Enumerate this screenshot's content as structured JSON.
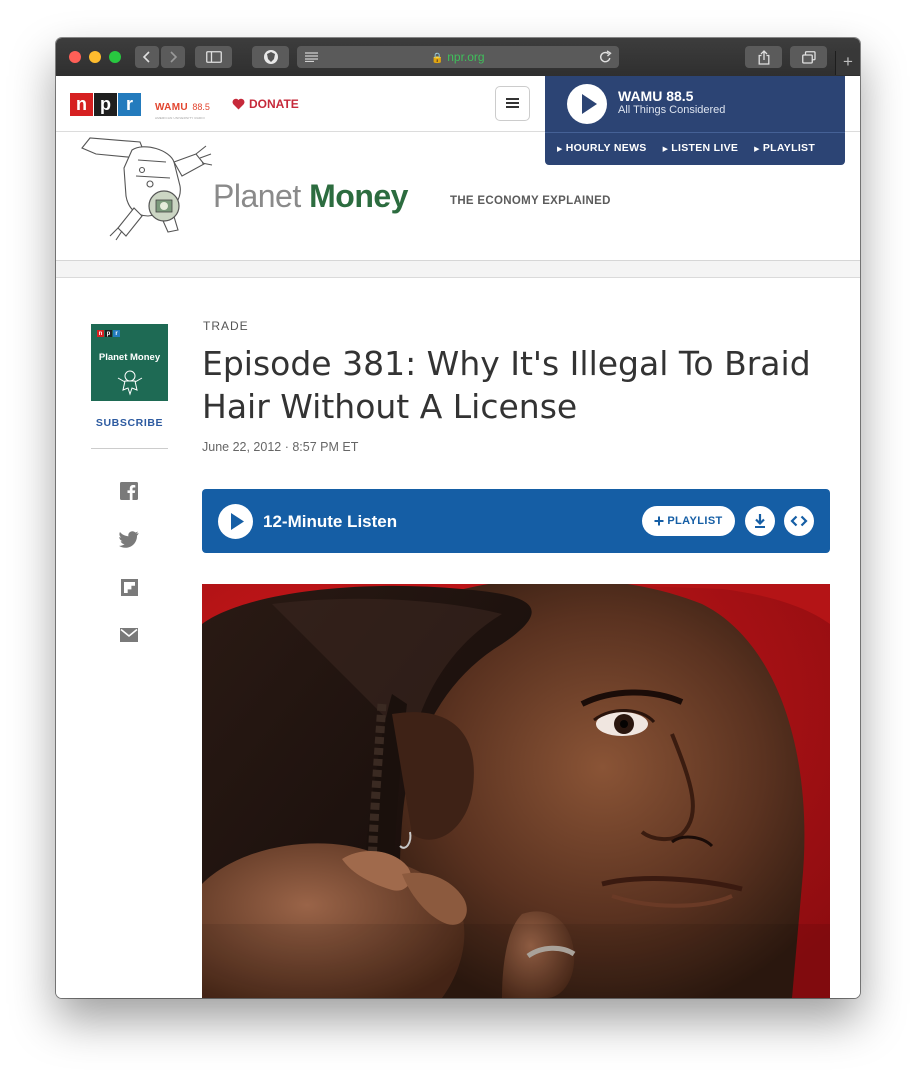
{
  "browser": {
    "url": "npr.org"
  },
  "header": {
    "npr_letters": [
      "n",
      "p",
      "r"
    ],
    "npr_colors": [
      "#d62021",
      "#1f1f1f",
      "#237bbd"
    ],
    "station_logo": "WAMU",
    "station_freq": "88.5",
    "station_tagline": "AMERICAN UNIVERSITY RADIO",
    "donate_label": "DONATE"
  },
  "radio": {
    "station": "WAMU 88.5",
    "program": "All Things Considered",
    "links": [
      "HOURLY NEWS",
      "LISTEN LIVE",
      "PLAYLIST"
    ]
  },
  "show": {
    "name_part1": "Planet",
    "name_part2": "Money",
    "tagline": "THE ECONOMY EXPLAINED",
    "cover_title": "Planet Money",
    "subscribe_label": "SUBSCRIBE",
    "brand_color": "#2c6c3f"
  },
  "share_icons": [
    "facebook-icon",
    "twitter-icon",
    "flipboard-icon",
    "email-icon"
  ],
  "article": {
    "slug": "TRADE",
    "headline": "Episode 381: Why It's Illegal To Braid Hair Without A License",
    "date": "June 22, 2012 · 8:57 PM ET"
  },
  "player": {
    "label": "12-Minute Listen",
    "playlist_label": "PLAYLIST",
    "color": "#155ea5"
  }
}
